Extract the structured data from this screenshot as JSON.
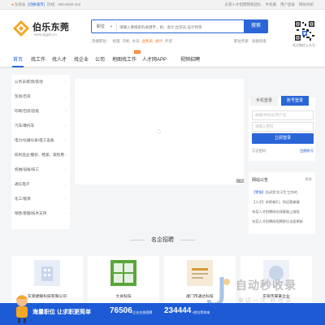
{
  "topbar": {
    "city": "东莞站",
    "switch": "[切换城市]",
    "hotline": "热线：400-8090-163",
    "links": [
      "东莞人才招聘网和团队",
      "手机端",
      "用户登录",
      "网站导航"
    ]
  },
  "header": {
    "brand": "伯乐东莞",
    "url": "www.dgjob.cn",
    "search": {
      "category": "职位",
      "placeholder": "请输入要搜索的关键字，如：会计,出货员,设计师等",
      "button": "搜索"
    },
    "hot_label": "热搜职位：",
    "hot": [
      "经理",
      "司机",
      "文员",
      "业务员",
      "会计",
      "外贸"
    ],
    "quick": [
      "职位检索",
      "高级检索"
    ],
    "qr_caption": "关注微信公众号"
  },
  "nav": {
    "items": [
      "首页",
      "找工作",
      "找人才",
      "找企业",
      "公司",
      "地图找工作",
      "人才网APP",
      "视频招聘"
    ],
    "active_index": 0,
    "new_tag": "new"
  },
  "categories": [
    "公务员/职场/其他",
    "贸易/百货",
    "印刷/包装/造纸",
    "汽车/摩托车",
    "电力/仪器仪表/电工设备",
    "纺织品业/服装、鞋类、家纺用",
    "机械/设备/技工",
    "通信电子",
    "化工/能源",
    "销售/客服/技术支持"
  ],
  "banner": {
    "ad_tag": "广告"
  },
  "login": {
    "tab_phone": "手机登录",
    "tab_account": "账号登录",
    "username_placeholder": "邮箱/手机号/用户名",
    "password_placeholder": "请输入密码",
    "submit": "立即登录",
    "forgot": "忘记密码",
    "register": "注册账号"
  },
  "notice": {
    "title": "网站公告",
    "more": "更多",
    "items": [
      {
        "badge": "【警惕】",
        "text": "告诉您'实习生'工作的"
      },
      {
        "badge": "",
        "text": "【人才】求职者们，你还要被骗"
      },
      {
        "badge": "",
        "text": "东莞人才招聘网在线客服上线啦"
      },
      {
        "badge": "",
        "text": "东莞人才招聘网招聘职位全面更新"
      }
    ]
  },
  "section": {
    "title": "名企招聘"
  },
  "companies": [
    {
      "name": "东莞捷联科技有限公司",
      "logo_color": "#e8eef8"
    },
    {
      "name": "大关科技",
      "logo_color": "#5aa63a"
    },
    {
      "name": "厦门市通达科技",
      "logo_color": "#f4ead6"
    },
    {
      "name": "东莞市某某企业",
      "logo_color": "#eef2f8"
    }
  ],
  "promo": {
    "title": "海量职位 让求职更简单",
    "count1": "76506",
    "unit1": "+企业在线招聘",
    "count2": "234444",
    "unit2": "+岗位等你来"
  },
  "watermark": {
    "line1": "自动秒收录",
    "line2": "来访一次 秒收录"
  },
  "colors": {
    "accent": "#2a66d8",
    "promo": "#1d5bd6",
    "orange": "#ff6600"
  }
}
